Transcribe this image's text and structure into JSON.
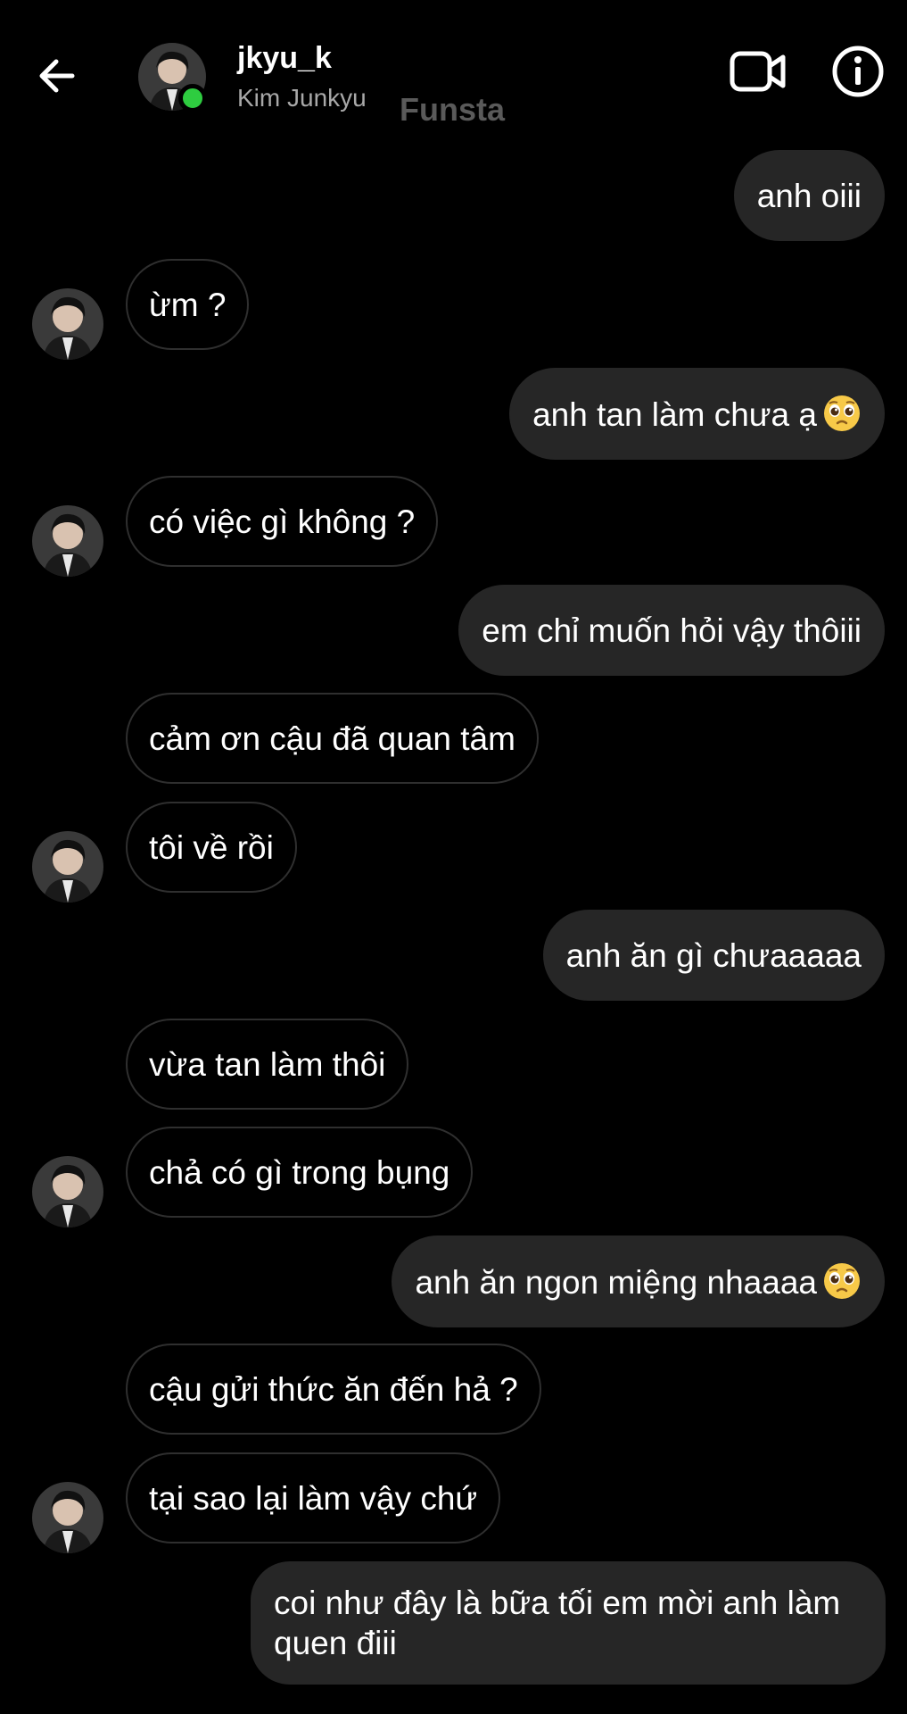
{
  "header": {
    "username": "jkyu_k",
    "real_name": "Kim Junkyu",
    "watermark": "Funsta",
    "back_icon": "arrow-left-icon",
    "video_icon": "video-camera-icon",
    "info_icon": "info-icon",
    "online_color": "#2ecc40"
  },
  "messages": [
    {
      "side": "out",
      "text": "anh oiii"
    },
    {
      "side": "in",
      "text": "ừm ?"
    },
    {
      "side": "out",
      "text": "anh tan làm chưa ạ",
      "emoji": "pleading-face-icon"
    },
    {
      "side": "in",
      "text": "có việc gì không ?"
    },
    {
      "side": "out",
      "text": "em chỉ muốn hỏi vậy thôiii"
    },
    {
      "side": "in",
      "text": "cảm ơn cậu đã quan tâm"
    },
    {
      "side": "in",
      "text": "tôi về rồi"
    },
    {
      "side": "out",
      "text": "anh ăn gì chưaaaaa"
    },
    {
      "side": "in",
      "text": "vừa tan làm thôi"
    },
    {
      "side": "in",
      "text": "chả có gì trong bụng"
    },
    {
      "side": "out",
      "text": "anh ăn ngon miệng nhaaaa",
      "emoji": "pleading-face-icon"
    },
    {
      "side": "in",
      "text": "cậu gửi thức ăn đến hả ?"
    },
    {
      "side": "in",
      "text": "tại sao lại làm vậy chứ"
    },
    {
      "side": "out",
      "text": "coi như đây là bữa tối em mời anh làm quen điii"
    }
  ],
  "colors": {
    "background": "#000000",
    "outgoing_bubble": "#262626",
    "incoming_border": "#2f2f2f",
    "secondary_text": "#a8a8a8"
  }
}
